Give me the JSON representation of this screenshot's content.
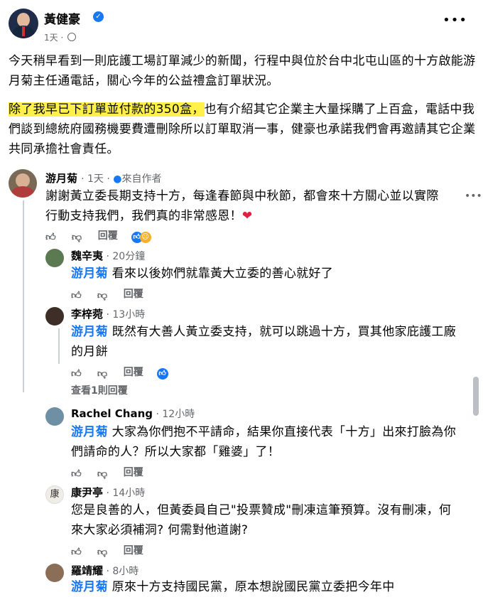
{
  "post": {
    "author": "黃健豪",
    "time": "1天",
    "paragraph1": "今天稍早看到一則庇護工場訂單減少的新聞，行程中與位於台中北屯山區的十方啟能游月菊主任通電話，關心今年的公益禮盒訂單狀況。",
    "paragraph2_highlight": "除了我早已下訂單並付款的350盒，",
    "paragraph2_rest": "也有介紹其它企業主大量採購了上百盒，電話中我們談到總統府國務機要費遭刪除所以訂單取消一事，健豪也承諾我們會再邀請其它企業共同承擔社會責任。"
  },
  "comments": [
    {
      "name": "游月菊",
      "time": "1天",
      "badge": "來自作者",
      "text": "謝謝黃立委長期支持十方，每逢春節與中秋節，都會來十方關心並以實際行動支持我們，我們真的非常感恩！",
      "reply_label": "回覆",
      "heart": "❤"
    },
    {
      "name": "魏辛夷",
      "time": "20分鐘",
      "mention": "游月菊",
      "text": "看來以後妳們就靠黃大立委的善心就好了",
      "reply_label": "回覆"
    },
    {
      "name": "李梓菀",
      "time": "13小時",
      "mention": "游月菊",
      "text": "既然有大善人黃立委支持，就可以跳過十方，買其他家庇護工廠的月餅",
      "reply_label": "回覆",
      "view_replies": "查看1則回覆"
    },
    {
      "name": "Rachel Chang",
      "time": "12小時",
      "mention": "游月菊",
      "text": "大家為你們抱不平請命，結果你直接代表「十方」出來打臉為你們請命的人？所以大家都「雞婆」了！",
      "reply_label": "回覆"
    },
    {
      "name": "康尹亭",
      "time": "14小時",
      "text": "您是良善的人，但黃委員自己\"投票贊成\"刪凍這筆預算。沒有刪凍，何來大家必須補洞? 何需對他道謝?",
      "reply_label": "回覆"
    },
    {
      "name": "羅靖耀",
      "time": "8小時",
      "mention": "游月菊",
      "text": "原來十方支持國民黨，原本想說國民黨立委把今年中"
    }
  ],
  "avatar4_char": "康",
  "icons": {
    "more": "more-options-icon",
    "verified": "verified-badge-icon",
    "like": "like-icon",
    "dislike": "dislike-icon",
    "globe": "globe-icon"
  },
  "colors": {
    "accent": "#1877f2",
    "highlight": "#fff14a",
    "muted": "#65676b"
  }
}
